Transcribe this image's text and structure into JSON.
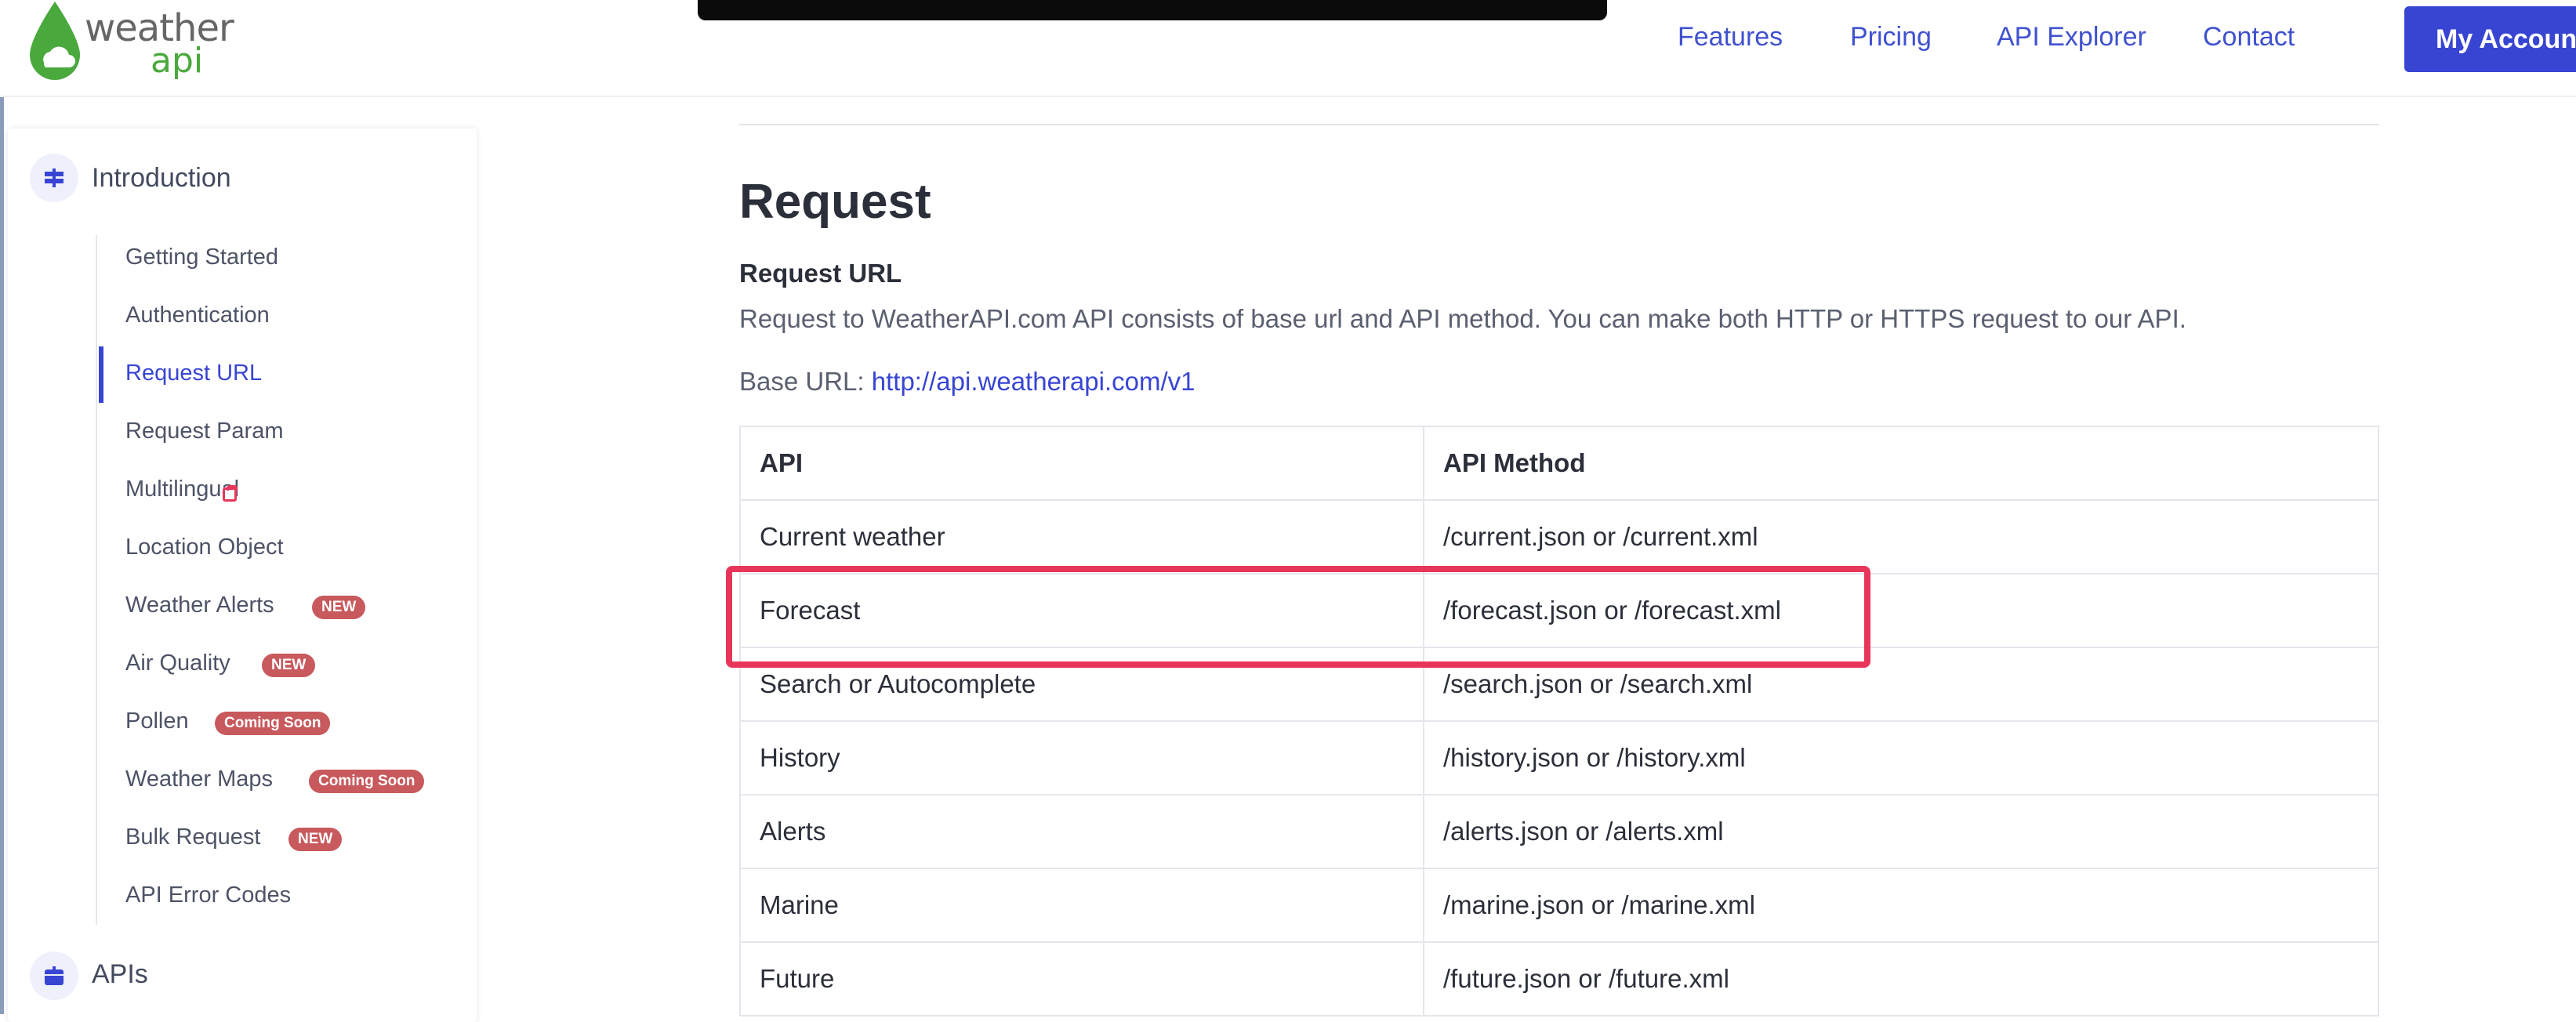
{
  "header": {
    "logo_word1": "weather",
    "logo_word2": "api",
    "nav": [
      "Features",
      "Pricing",
      "API Explorer",
      "Contact"
    ],
    "account_button": "My Accoun"
  },
  "sidebar": {
    "section1": "Introduction",
    "items": [
      {
        "label": "Getting Started",
        "badge": ""
      },
      {
        "label": "Authentication",
        "badge": ""
      },
      {
        "label": "Request URL",
        "badge": "",
        "active": true
      },
      {
        "label": "Request Param",
        "badge": ""
      },
      {
        "label": "Multilingual",
        "badge": ""
      },
      {
        "label": "Location Object",
        "badge": ""
      },
      {
        "label": "Weather Alerts",
        "badge": "NEW"
      },
      {
        "label": "Air Quality",
        "badge": "NEW"
      },
      {
        "label": "Pollen",
        "badge": "Coming Soon"
      },
      {
        "label": "Weather Maps",
        "badge": "Coming Soon"
      },
      {
        "label": "Bulk Request",
        "badge": "NEW"
      },
      {
        "label": "API Error Codes",
        "badge": ""
      }
    ],
    "section2": "APIs"
  },
  "main": {
    "heading": "Request",
    "subheading": "Request URL",
    "description": "Request to WeatherAPI.com API consists of base url and API method. You can make both HTTP or HTTPS request to our API.",
    "base_label": "Base URL:",
    "base_url": "http://api.weatherapi.com/v1",
    "table": {
      "headers": [
        "API",
        "API Method"
      ],
      "rows": [
        [
          "Current weather",
          "/current.json or /current.xml"
        ],
        [
          "Forecast",
          "/forecast.json or /forecast.xml"
        ],
        [
          "Search or Autocomplete",
          "/search.json or /search.xml"
        ],
        [
          "History",
          "/history.json or /history.xml"
        ],
        [
          "Alerts",
          "/alerts.json or /alerts.xml"
        ],
        [
          "Marine",
          "/marine.json or /marine.xml"
        ],
        [
          "Future",
          "/future.json or /future.xml"
        ]
      ]
    }
  },
  "colors": {
    "accent": "#3845d3",
    "badge": "#c8595d",
    "highlight": "#e8365a",
    "logo_green": "#4aa93d"
  }
}
